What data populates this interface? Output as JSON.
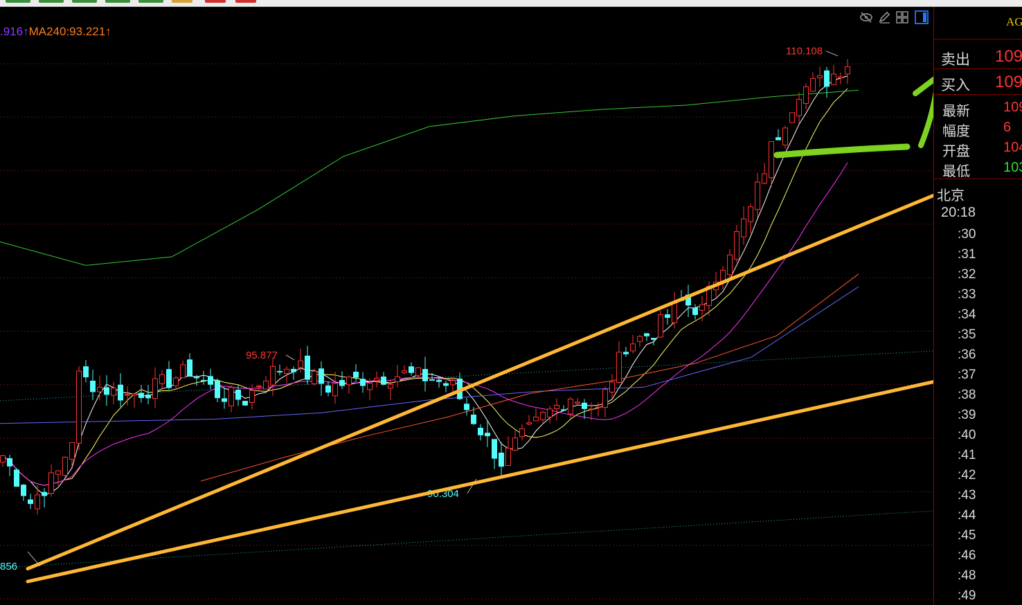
{
  "toolbar": {
    "button_colors": [
      "#3c8f3c",
      "#3c8f3c",
      "#3c8f3c",
      "#3c8f3c",
      "#3c8f3c",
      "#d6a23a",
      "#d03030",
      "#d03030"
    ]
  },
  "legend": {
    "ma_prev_text": ".916↑",
    "ma_prev_color": "#8a3cff",
    "ma240_text": "MA240:93.221↑",
    "ma240_color": "#ff7a1a"
  },
  "tool_icons": [
    "eye-slash-icon",
    "pencil-icon",
    "grid-icon",
    "panel-toggle-icon"
  ],
  "chart_data": {
    "type": "candlestick",
    "title": "",
    "xlabel": "",
    "ylabel": "",
    "ylim": [
      84.4,
      112.4
    ],
    "grid": "horizontal dotted",
    "candle_count": 123,
    "up_color": "#ff3333",
    "down_color": "#54fcfc",
    "series": [
      {
        "name": "",
        "values": [
          91.4,
          91.5,
          91.3,
          91.1,
          90.7,
          90.6,
          91.1,
          91.4,
          92.5,
          93.8,
          93.4,
          93.1
        ]
      },
      {
        "name": "",
        "values": [
          93.5,
          92.8,
          92.5,
          93.2,
          93.5,
          93.1,
          92.8,
          93.1,
          93.9,
          95.0,
          94.3,
          93.6,
          93.8,
          95.4
        ]
      },
      {
        "name": "",
        "values": [
          93.6,
          93.8,
          92.4,
          91.6,
          91.7,
          92.1,
          93.1,
          92.3,
          94.4,
          95.2,
          94.6,
          94.0,
          94.6,
          95.9
        ]
      },
      {
        "name": "",
        "values": [
          101.4,
          100.3,
          100.7,
          102.9,
          105.4,
          106.8,
          107.3,
          107.6,
          107.8,
          108.2,
          108.5
        ]
      },
      {
        "name": "",
        "values": [
          92.9,
          93.0,
          93.1,
          93.4,
          94.0,
          94.4,
          94.6,
          96.0,
          99.3
        ]
      },
      {
        "name": "",
        "values": [
          90.2,
          91.3,
          92.3,
          93.2,
          94.3,
          94.9,
          95.7,
          97.0,
          99.9
        ]
      }
    ],
    "series_colors": [
      "#ffffff",
      "#ffff66",
      "#ff33ff",
      "#33cc33",
      "#6666ff",
      "#ff5533"
    ],
    "annotations": [
      {
        "text": "110.108",
        "x": 0.8,
        "y": 110.108,
        "color": "#ff3333"
      },
      {
        "text": "95.877",
        "x": 0.3,
        "y": 95.877,
        "color": "#ff3333"
      },
      {
        "text": "90.304",
        "x": 0.5,
        "y": 90.304,
        "color": "#54fcfc"
      },
      {
        "text": "856",
        "x": 0.0,
        "y": 86.9,
        "color": "#54fcfc"
      }
    ],
    "trendlines": [
      {
        "from": [
          86.1
        ],
        "to": [
          104.2
        ],
        "color": "#ffb833"
      },
      {
        "from": [
          85.5
        ],
        "to": [
          95.4
        ],
        "color": "#ffb833"
      }
    ],
    "markups": [
      {
        "kind": "underline",
        "color": "#7ed321"
      },
      {
        "kind": "arrow-up",
        "color": "#7ed321"
      },
      {
        "kind": "arrow-up",
        "color": "#7ed321"
      }
    ]
  },
  "quote_panel": {
    "code": "AG",
    "ask_label": "卖出",
    "ask_value": "109",
    "bid_label": "买入",
    "bid_value": "109",
    "rows": [
      {
        "label": "最新",
        "value": "109",
        "color": "#ff3333"
      },
      {
        "label": "幅度",
        "value": "6",
        "color": "#ff3333"
      },
      {
        "label": "开盘",
        "value": "104",
        "color": "#ff3333"
      },
      {
        "label": "最低",
        "value": "103",
        "color": "#33dd33"
      }
    ],
    "city": "北京",
    "time": "20:18",
    "minutes": [
      ":30",
      ":31",
      ":32",
      ":33",
      ":34",
      ":35",
      ":36",
      ":37",
      ":38",
      ":39",
      ":40",
      ":41",
      ":42",
      ":43",
      ":44",
      ":45",
      ":46",
      ":48",
      ":49"
    ]
  }
}
